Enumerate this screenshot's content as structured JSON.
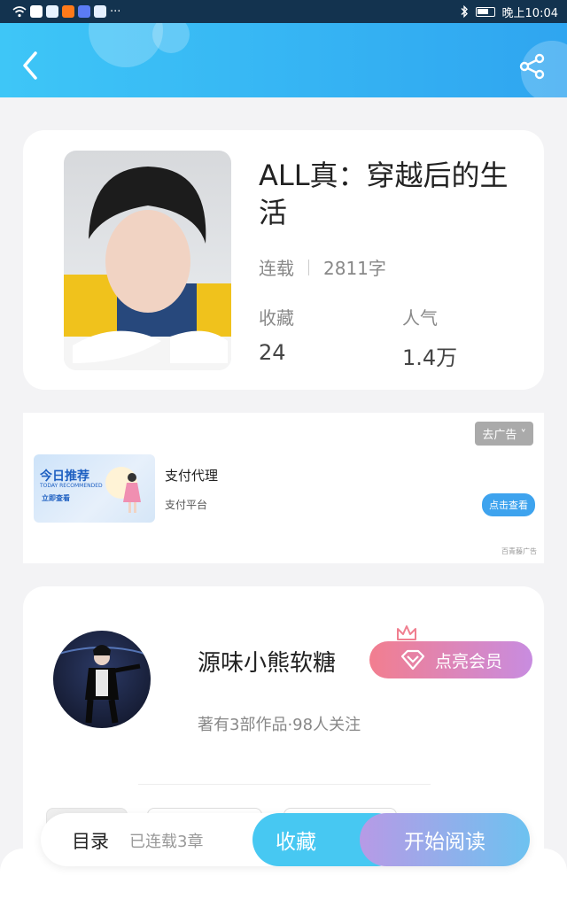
{
  "status_bar": {
    "time": "晚上10:04",
    "dots": "···"
  },
  "book": {
    "title": "ALL真：穿越后的生活",
    "status": "连载",
    "word_count": "2811字",
    "favorites_label": "收藏",
    "favorites_value": "24",
    "popularity_label": "人气",
    "popularity_value": "1.4万"
  },
  "ad": {
    "close_label": "去广告",
    "image_title": "今日推荐",
    "image_subtitle": "TODAY RECOMMENDED",
    "image_button": "立即查看",
    "title": "支付代理",
    "description": "支付平台",
    "cta_label": "点击查看",
    "source": "百青藤广告"
  },
  "author": {
    "name": "源味小熊软糖",
    "meta": "著有3部作品·98人关注",
    "vip_label": "点亮会员"
  },
  "bottom_bar": {
    "toc_label": "目录",
    "chapters_label": "已连载3章",
    "favorite_label": "收藏",
    "read_label": "开始阅读"
  },
  "colors": {
    "header_start": "#3ec6f7",
    "header_end": "#2fa5f0",
    "vip_start": "#f27e8f",
    "vip_end": "#c88ce0",
    "favorite_button": "#47c8f2"
  }
}
